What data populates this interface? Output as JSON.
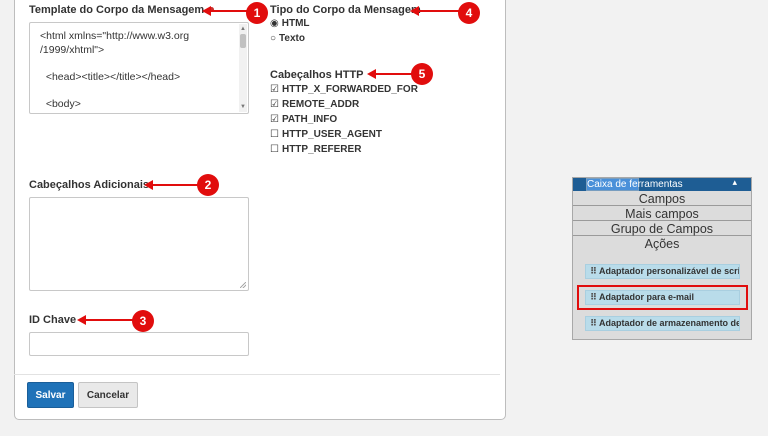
{
  "form": {
    "template_label": "Template do Corpo da Mensagem",
    "template_value": "<html xmlns=\"http://www.w3.org\n/1999/xhtml\">\n\n  <head><title></title></head>\n\n  <body>",
    "additional_headers_label": "Cabeçalhos Adicionais",
    "additional_headers_value": "",
    "key_id_label": "ID Chave",
    "key_id_value": "",
    "body_type_label": "Tipo do Corpo da Mensagem",
    "body_type_options": [
      {
        "label": "HTML",
        "selected": true
      },
      {
        "label": "Texto",
        "selected": false
      }
    ],
    "http_headers_label": "Cabeçalhos HTTP",
    "http_headers": [
      {
        "label": "HTTP_X_FORWARDED_FOR",
        "checked": true
      },
      {
        "label": "REMOTE_ADDR",
        "checked": true
      },
      {
        "label": "PATH_INFO",
        "checked": true
      },
      {
        "label": "HTTP_USER_AGENT",
        "checked": false
      },
      {
        "label": "HTTP_REFERER",
        "checked": false
      }
    ],
    "save_label": "Salvar",
    "cancel_label": "Cancelar"
  },
  "annotations": {
    "badge_1": "1",
    "badge_2": "2",
    "badge_3": "3",
    "badge_4": "4",
    "badge_5": "5",
    "color": "#e10d0d"
  },
  "toolbox": {
    "title_part1": "Caixa de fe",
    "title_part2": "rramentas",
    "collapse_icon": "▴",
    "sections": [
      "Campos",
      "Mais campos",
      "Grupo de Campos",
      "Ações"
    ],
    "items": [
      "Adaptador personalizável de scri",
      "Adaptador para e-mail",
      "Adaptador de armazenamento de"
    ],
    "header_color": "#1e5d94",
    "item_color": "#b9dcea"
  },
  "colors": {
    "primary_button": "#1f72b8",
    "required_dot": "#c9302c"
  }
}
